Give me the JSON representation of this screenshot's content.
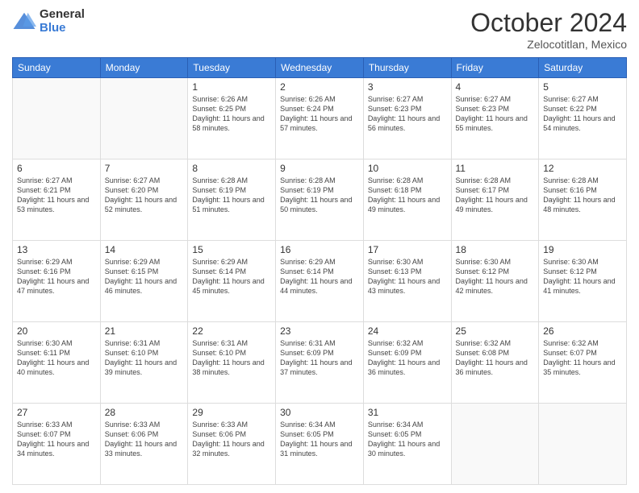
{
  "header": {
    "logo_general": "General",
    "logo_blue": "Blue",
    "month_title": "October 2024",
    "location": "Zelocotitlan, Mexico"
  },
  "days_of_week": [
    "Sunday",
    "Monday",
    "Tuesday",
    "Wednesday",
    "Thursday",
    "Friday",
    "Saturday"
  ],
  "weeks": [
    [
      {
        "day": "",
        "sunrise": "",
        "sunset": "",
        "daylight": "",
        "empty": true
      },
      {
        "day": "",
        "sunrise": "",
        "sunset": "",
        "daylight": "",
        "empty": true
      },
      {
        "day": "1",
        "sunrise": "Sunrise: 6:26 AM",
        "sunset": "Sunset: 6:25 PM",
        "daylight": "Daylight: 11 hours and 58 minutes.",
        "empty": false
      },
      {
        "day": "2",
        "sunrise": "Sunrise: 6:26 AM",
        "sunset": "Sunset: 6:24 PM",
        "daylight": "Daylight: 11 hours and 57 minutes.",
        "empty": false
      },
      {
        "day": "3",
        "sunrise": "Sunrise: 6:27 AM",
        "sunset": "Sunset: 6:23 PM",
        "daylight": "Daylight: 11 hours and 56 minutes.",
        "empty": false
      },
      {
        "day": "4",
        "sunrise": "Sunrise: 6:27 AM",
        "sunset": "Sunset: 6:23 PM",
        "daylight": "Daylight: 11 hours and 55 minutes.",
        "empty": false
      },
      {
        "day": "5",
        "sunrise": "Sunrise: 6:27 AM",
        "sunset": "Sunset: 6:22 PM",
        "daylight": "Daylight: 11 hours and 54 minutes.",
        "empty": false
      }
    ],
    [
      {
        "day": "6",
        "sunrise": "Sunrise: 6:27 AM",
        "sunset": "Sunset: 6:21 PM",
        "daylight": "Daylight: 11 hours and 53 minutes.",
        "empty": false
      },
      {
        "day": "7",
        "sunrise": "Sunrise: 6:27 AM",
        "sunset": "Sunset: 6:20 PM",
        "daylight": "Daylight: 11 hours and 52 minutes.",
        "empty": false
      },
      {
        "day": "8",
        "sunrise": "Sunrise: 6:28 AM",
        "sunset": "Sunset: 6:19 PM",
        "daylight": "Daylight: 11 hours and 51 minutes.",
        "empty": false
      },
      {
        "day": "9",
        "sunrise": "Sunrise: 6:28 AM",
        "sunset": "Sunset: 6:19 PM",
        "daylight": "Daylight: 11 hours and 50 minutes.",
        "empty": false
      },
      {
        "day": "10",
        "sunrise": "Sunrise: 6:28 AM",
        "sunset": "Sunset: 6:18 PM",
        "daylight": "Daylight: 11 hours and 49 minutes.",
        "empty": false
      },
      {
        "day": "11",
        "sunrise": "Sunrise: 6:28 AM",
        "sunset": "Sunset: 6:17 PM",
        "daylight": "Daylight: 11 hours and 49 minutes.",
        "empty": false
      },
      {
        "day": "12",
        "sunrise": "Sunrise: 6:28 AM",
        "sunset": "Sunset: 6:16 PM",
        "daylight": "Daylight: 11 hours and 48 minutes.",
        "empty": false
      }
    ],
    [
      {
        "day": "13",
        "sunrise": "Sunrise: 6:29 AM",
        "sunset": "Sunset: 6:16 PM",
        "daylight": "Daylight: 11 hours and 47 minutes.",
        "empty": false
      },
      {
        "day": "14",
        "sunrise": "Sunrise: 6:29 AM",
        "sunset": "Sunset: 6:15 PM",
        "daylight": "Daylight: 11 hours and 46 minutes.",
        "empty": false
      },
      {
        "day": "15",
        "sunrise": "Sunrise: 6:29 AM",
        "sunset": "Sunset: 6:14 PM",
        "daylight": "Daylight: 11 hours and 45 minutes.",
        "empty": false
      },
      {
        "day": "16",
        "sunrise": "Sunrise: 6:29 AM",
        "sunset": "Sunset: 6:14 PM",
        "daylight": "Daylight: 11 hours and 44 minutes.",
        "empty": false
      },
      {
        "day": "17",
        "sunrise": "Sunrise: 6:30 AM",
        "sunset": "Sunset: 6:13 PM",
        "daylight": "Daylight: 11 hours and 43 minutes.",
        "empty": false
      },
      {
        "day": "18",
        "sunrise": "Sunrise: 6:30 AM",
        "sunset": "Sunset: 6:12 PM",
        "daylight": "Daylight: 11 hours and 42 minutes.",
        "empty": false
      },
      {
        "day": "19",
        "sunrise": "Sunrise: 6:30 AM",
        "sunset": "Sunset: 6:12 PM",
        "daylight": "Daylight: 11 hours and 41 minutes.",
        "empty": false
      }
    ],
    [
      {
        "day": "20",
        "sunrise": "Sunrise: 6:30 AM",
        "sunset": "Sunset: 6:11 PM",
        "daylight": "Daylight: 11 hours and 40 minutes.",
        "empty": false
      },
      {
        "day": "21",
        "sunrise": "Sunrise: 6:31 AM",
        "sunset": "Sunset: 6:10 PM",
        "daylight": "Daylight: 11 hours and 39 minutes.",
        "empty": false
      },
      {
        "day": "22",
        "sunrise": "Sunrise: 6:31 AM",
        "sunset": "Sunset: 6:10 PM",
        "daylight": "Daylight: 11 hours and 38 minutes.",
        "empty": false
      },
      {
        "day": "23",
        "sunrise": "Sunrise: 6:31 AM",
        "sunset": "Sunset: 6:09 PM",
        "daylight": "Daylight: 11 hours and 37 minutes.",
        "empty": false
      },
      {
        "day": "24",
        "sunrise": "Sunrise: 6:32 AM",
        "sunset": "Sunset: 6:09 PM",
        "daylight": "Daylight: 11 hours and 36 minutes.",
        "empty": false
      },
      {
        "day": "25",
        "sunrise": "Sunrise: 6:32 AM",
        "sunset": "Sunset: 6:08 PM",
        "daylight": "Daylight: 11 hours and 36 minutes.",
        "empty": false
      },
      {
        "day": "26",
        "sunrise": "Sunrise: 6:32 AM",
        "sunset": "Sunset: 6:07 PM",
        "daylight": "Daylight: 11 hours and 35 minutes.",
        "empty": false
      }
    ],
    [
      {
        "day": "27",
        "sunrise": "Sunrise: 6:33 AM",
        "sunset": "Sunset: 6:07 PM",
        "daylight": "Daylight: 11 hours and 34 minutes.",
        "empty": false
      },
      {
        "day": "28",
        "sunrise": "Sunrise: 6:33 AM",
        "sunset": "Sunset: 6:06 PM",
        "daylight": "Daylight: 11 hours and 33 minutes.",
        "empty": false
      },
      {
        "day": "29",
        "sunrise": "Sunrise: 6:33 AM",
        "sunset": "Sunset: 6:06 PM",
        "daylight": "Daylight: 11 hours and 32 minutes.",
        "empty": false
      },
      {
        "day": "30",
        "sunrise": "Sunrise: 6:34 AM",
        "sunset": "Sunset: 6:05 PM",
        "daylight": "Daylight: 11 hours and 31 minutes.",
        "empty": false
      },
      {
        "day": "31",
        "sunrise": "Sunrise: 6:34 AM",
        "sunset": "Sunset: 6:05 PM",
        "daylight": "Daylight: 11 hours and 30 minutes.",
        "empty": false
      },
      {
        "day": "",
        "sunrise": "",
        "sunset": "",
        "daylight": "",
        "empty": true
      },
      {
        "day": "",
        "sunrise": "",
        "sunset": "",
        "daylight": "",
        "empty": true
      }
    ]
  ]
}
